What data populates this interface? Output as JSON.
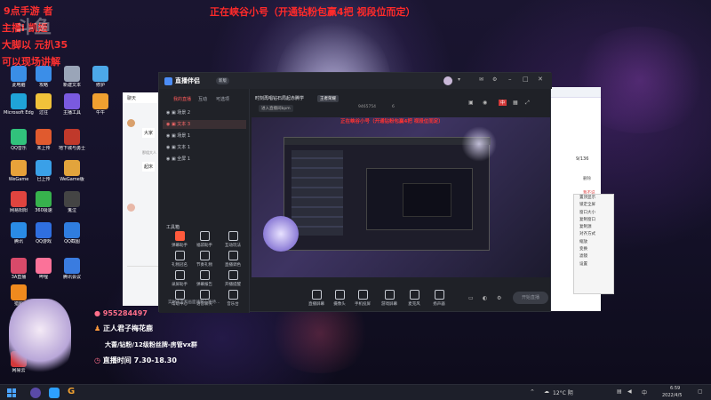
{
  "overlay": {
    "top_banner": "正在峡谷小号（开通钻粉包赢4把 视段位而定）",
    "left_lines": [
      "9点手游 者",
      "主播i 凯姬",
      "大脚以 元扒35",
      "可以现场讲解"
    ],
    "watermark": "斗鱼"
  },
  "desktop_icons": [
    {
      "label": "此电脑",
      "color": "#3a8ee6"
    },
    {
      "label": "Microsoft Edge",
      "color": "#1fa3d8"
    },
    {
      "label": "QQ音乐",
      "color": "#31c27c"
    },
    {
      "label": "WeGame",
      "color": "#e8a23a"
    },
    {
      "label": "网易阳阳",
      "color": "#e0443f"
    },
    {
      "label": "腾讯",
      "color": "#2a8be6"
    },
    {
      "label": "3A直播",
      "color": "#d84a6a"
    },
    {
      "label": "猎豹",
      "color": "#f08a1e"
    },
    {
      "label": "腾讯QQ",
      "color": "#1d9bf0"
    },
    {
      "label": "网易云",
      "color": "#d4383a"
    },
    {
      "label": "攻略",
      "color": "#3b8ee8"
    },
    {
      "label": "过往",
      "color": "#f0c23a"
    },
    {
      "label": "未上传",
      "color": "#e05a2e"
    },
    {
      "label": "巳上传",
      "color": "#3aa0e8"
    },
    {
      "label": "360极速",
      "color": "#37b24d"
    },
    {
      "label": "QQ游戏",
      "color": "#2f6fe0"
    },
    {
      "label": "哔哩",
      "color": "#fb7299"
    },
    {
      "label": "新建文本",
      "color": "#9aa5b8"
    },
    {
      "label": "主播工具",
      "color": "#7a5ae0"
    },
    {
      "label": "地下城与勇士",
      "color": "#c0392b"
    },
    {
      "label": "WeGame版",
      "color": "#e2a43c"
    },
    {
      "label": "鬼泣",
      "color": "#444"
    },
    {
      "label": "QQ截图",
      "color": "#2f7de0"
    },
    {
      "label": "腾讯会议",
      "color": "#3a7ce0"
    },
    {
      "label": "修护",
      "color": "#4ca8e8"
    },
    {
      "label": "牛牛",
      "color": "#f0a030"
    }
  ],
  "chat_window": {
    "title": "聊天",
    "msg1": "大家",
    "msg2": "起床",
    "sender": "那组大人"
  },
  "app": {
    "name": "直播伴侣",
    "version": "新版",
    "tabs": [
      "我的直播",
      "互动",
      "可选项"
    ],
    "stream_title": "时刻再唱钻石局起赤腾学",
    "tag_game": "王者荣耀",
    "tag_mode": "进入直播间bpm",
    "room_id": "9465754",
    "follower_count": "6",
    "status_badge": "中",
    "scenes": [
      "场景 2",
      "文本 3",
      "场景 1",
      "文本 1",
      "全屏 1"
    ],
    "tools_title": "工具箱",
    "tools": [
      "弹幕助手",
      "福袋助手",
      "互动玩法",
      "礼物冠名",
      "节奏礼物",
      "直播调色",
      "录屏助手",
      "弹幕报告",
      "开播提醒",
      "帮助中心",
      "语音聊天",
      "音乐台"
    ],
    "bottom_tools": [
      "直播屏幕",
      "摄像头",
      "手机投屏",
      "游戏屏幕",
      "麦克风",
      "扬声器"
    ],
    "start_button": "开始直播",
    "bottom_hint": "实时声音和画面请耐心等待…",
    "inner_banner": "正在峡谷小号（开通钻粉包赢4把 视段位而定）",
    "context_menu": [
      "置顶显示",
      "锁定全屏",
      "窗口大小",
      "复制窗口",
      "复制源",
      "对齐方式",
      "缩放",
      "变换",
      "滤镜",
      "设置"
    ]
  },
  "right_window": {
    "count": "9/136",
    "rows": [
      "删除",
      "我不说",
      "关闭了",
      "兄弟",
      "点赞",
      "小明",
      "弹幕",
      "回复"
    ]
  },
  "stream_info": {
    "id": "955284497",
    "name": "正人君子梅花鹿",
    "rank_line": "大蔷/钻粉/12级粉丝牌-房管vx群",
    "time_line": "直播时间 7.30-18.30"
  },
  "taskbar": {
    "weather": "12°C 阴",
    "time": "6:59",
    "date": "2022/4/5",
    "lang": "中"
  }
}
